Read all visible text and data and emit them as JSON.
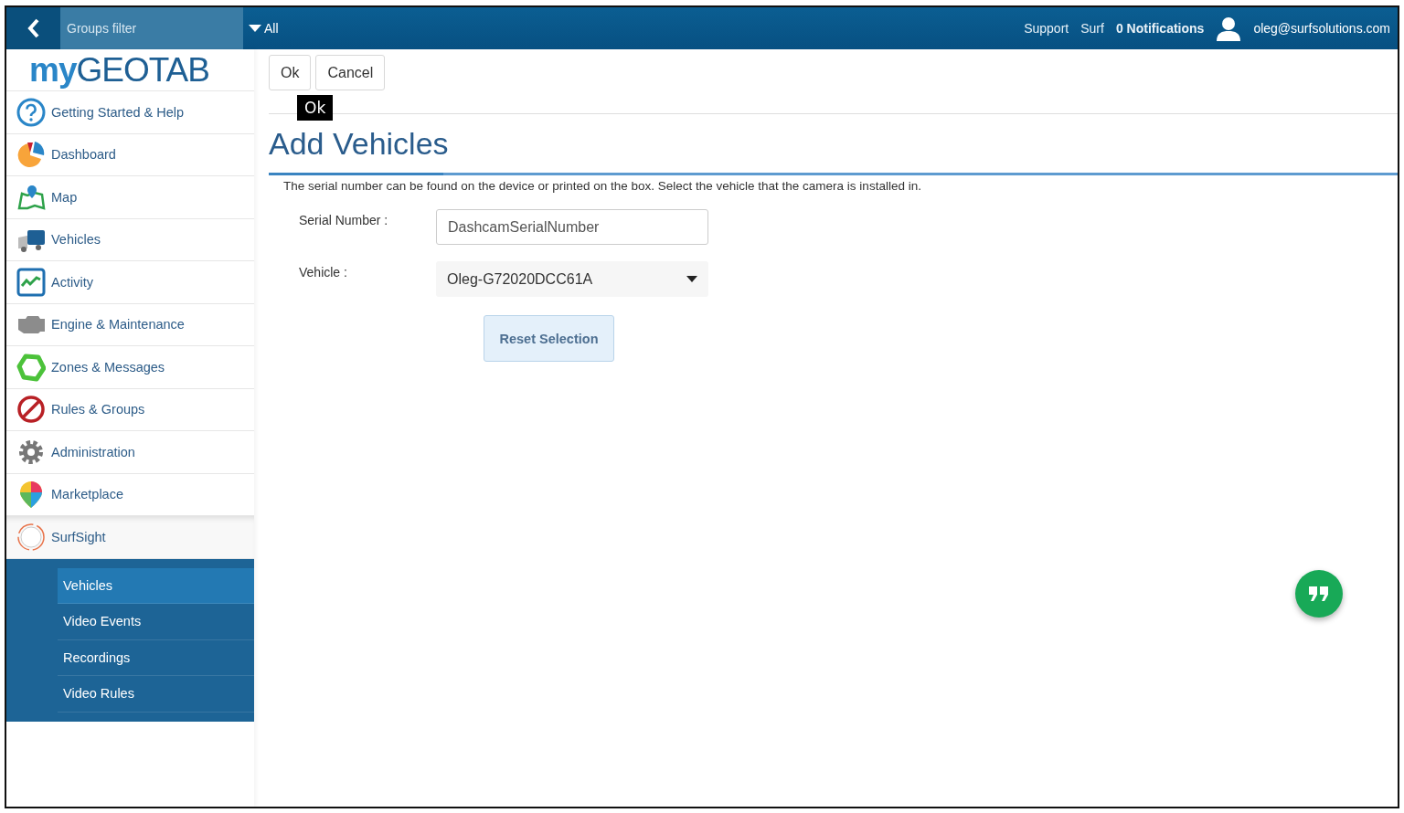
{
  "topbar": {
    "groups_filter": "Groups filter",
    "filter_value": "All",
    "links": [
      {
        "label": "Support",
        "bold": false
      },
      {
        "label": "Surf",
        "bold": false
      },
      {
        "label": "0 Notifications",
        "bold": true
      }
    ],
    "user": "oleg@surfsolutions.com"
  },
  "logo": {
    "prefix": "my",
    "name": "GEOTAB"
  },
  "sidebar": {
    "items": [
      {
        "label": "Getting Started & Help",
        "kind": "help",
        "expanded": false
      },
      {
        "label": "Dashboard",
        "kind": "dashboard",
        "expanded": false
      },
      {
        "label": "Map",
        "kind": "map",
        "expanded": false
      },
      {
        "label": "Vehicles",
        "kind": "vehicles",
        "expanded": false
      },
      {
        "label": "Activity",
        "kind": "activity",
        "expanded": false
      },
      {
        "label": "Engine & Maintenance",
        "kind": "engine",
        "expanded": false
      },
      {
        "label": "Zones & Messages",
        "kind": "zones",
        "expanded": false
      },
      {
        "label": "Rules & Groups",
        "kind": "rules",
        "expanded": false
      },
      {
        "label": "Administration",
        "kind": "admin",
        "expanded": false
      },
      {
        "label": "Marketplace",
        "kind": "marketplace",
        "expanded": false
      },
      {
        "label": "SurfSight",
        "kind": "surfsight",
        "expanded": true,
        "children": [
          {
            "label": "Vehicles",
            "selected": true
          },
          {
            "label": "Video Events",
            "selected": false
          },
          {
            "label": "Recordings",
            "selected": false
          },
          {
            "label": "Video Rules",
            "selected": false
          }
        ]
      }
    ]
  },
  "toolbar": {
    "buttons": [
      "Ok",
      "Cancel"
    ],
    "tooltip": "Ok"
  },
  "page": {
    "title": "Add Vehicles",
    "description": "The serial number can be found on the device or printed on the box. Select the vehicle that the camera is installed in.",
    "fields": [
      {
        "kind": "text",
        "label": "Serial Number :",
        "placeholder": "DashcamSerialNumber"
      },
      {
        "kind": "select",
        "label": "Vehicle :",
        "value": "Oleg-G72020DCC61A"
      }
    ],
    "reset_button": "Reset Selection"
  }
}
